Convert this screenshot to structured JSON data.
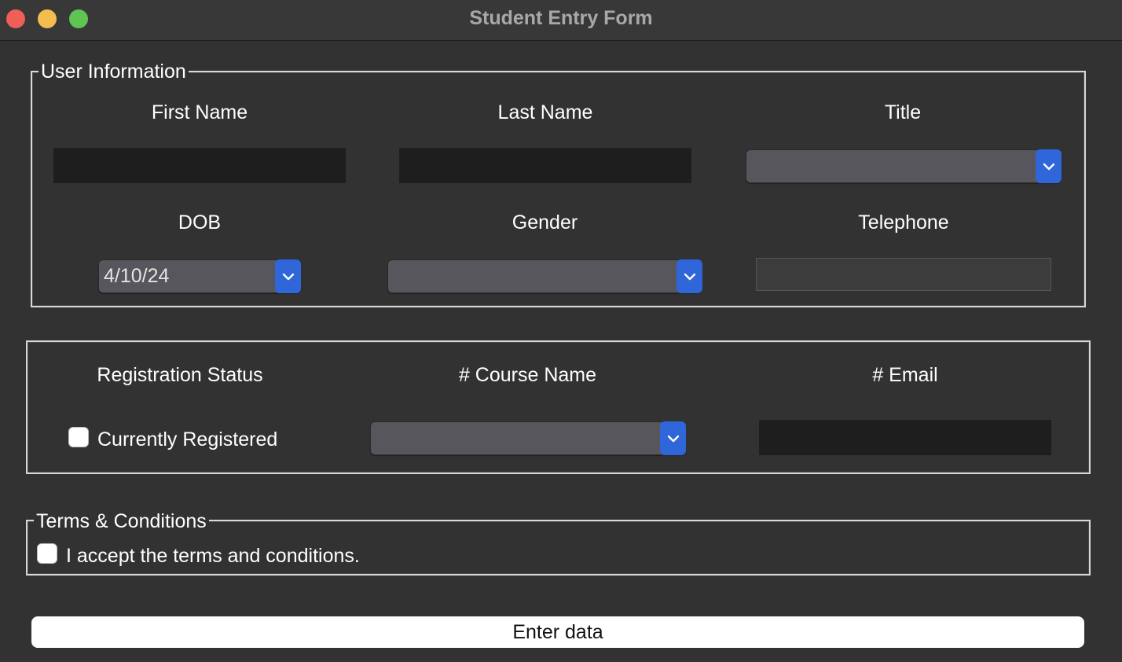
{
  "window": {
    "title": "Student Entry Form"
  },
  "user_info": {
    "legend": "User Information",
    "first_name_label": "First Name",
    "last_name_label": "Last Name",
    "title_label": "Title",
    "dob_label": "DOB",
    "gender_label": "Gender",
    "telephone_label": "Telephone",
    "first_name_value": "",
    "last_name_value": "",
    "title_value": "",
    "dob_value": "4/10/24",
    "gender_value": "",
    "telephone_value": ""
  },
  "registration": {
    "status_label": "Registration Status",
    "course_label": "# Course Name",
    "email_label": "# Email",
    "registered_checkbox_label": "Currently Registered",
    "registered_checked": false,
    "course_value": "",
    "email_value": ""
  },
  "terms": {
    "legend": "Terms & Conditions",
    "accept_label": "I accept the terms and conditions.",
    "accept_checked": false
  },
  "actions": {
    "enter_label": "Enter data"
  },
  "colors": {
    "background": "#323232",
    "accent": "#2f66d9",
    "combo": "#57565c",
    "entry": "#1e1e1e"
  },
  "icons": {
    "window_close": "close-icon",
    "window_minimize": "minimize-icon",
    "window_maximize": "maximize-icon",
    "dropdown": "chevron-down-icon"
  }
}
